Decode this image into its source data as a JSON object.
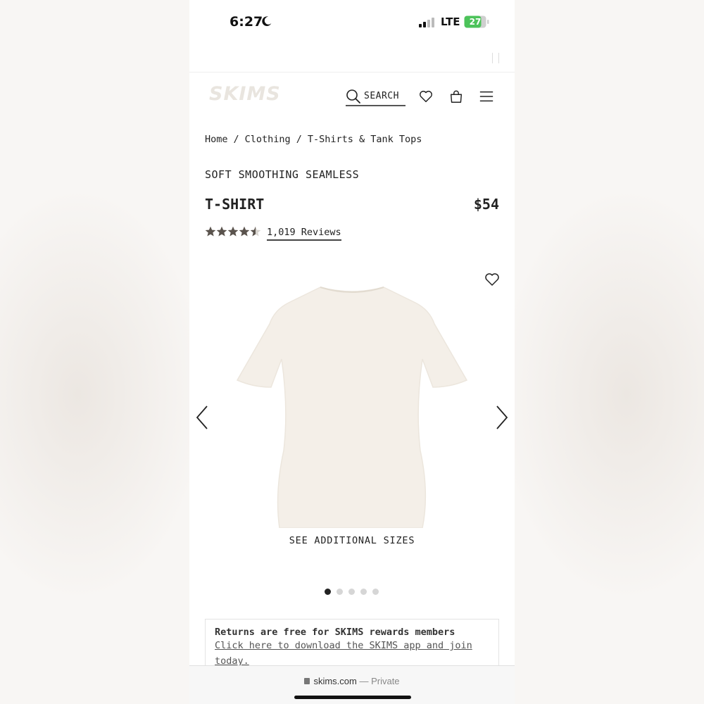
{
  "status_bar": {
    "time": "6:27",
    "network": "LTE",
    "battery": "27"
  },
  "header": {
    "logo": "SKIMS",
    "search_label": "SEARCH"
  },
  "breadcrumb": [
    "Home",
    "Clothing",
    "T-Shirts & Tank Tops"
  ],
  "breadcrumb_separator": "/",
  "product": {
    "subtitle": "SOFT SMOOTHING SEAMLESS",
    "title": "T-SHIRT",
    "price": "$54",
    "rating": 4.5,
    "rating_max": 5,
    "reviews": "1,019 Reviews",
    "image_color": "#f4efe8",
    "sizes_link": "SEE ADDITIONAL SIZES",
    "carousel_pages": 5,
    "carousel_active": 1
  },
  "returns": {
    "title": "Returns are free for SKIMS rewards members",
    "link": "Click here to download the SKIMS app and join today."
  },
  "browser": {
    "domain": "skims.com",
    "mode": "— Private"
  },
  "colors": {
    "star": "#5a534d",
    "text": "#222222",
    "logo": "#e9e5df"
  },
  "icons": [
    "moon-icon",
    "signal-icon",
    "battery-icon",
    "search-icon",
    "heart-icon",
    "bag-icon",
    "menu-icon",
    "star-icon",
    "chevron-left-icon",
    "chevron-right-icon",
    "lock-icon"
  ]
}
